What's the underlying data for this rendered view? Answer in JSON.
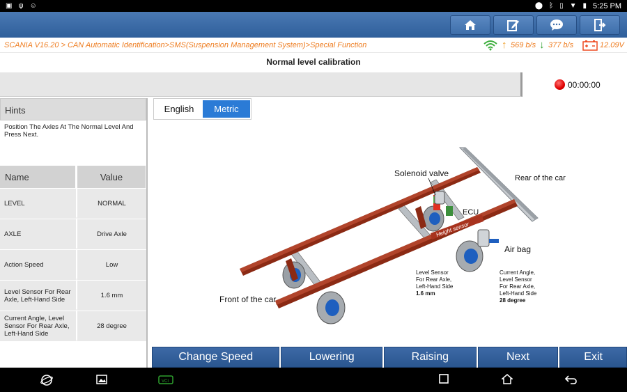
{
  "status_bar": {
    "time": "5:25 PM"
  },
  "breadcrumb": "SCANIA V16.20 > CAN Automatic Identification>SMS(Suspension Management System)>Special Function",
  "rates": {
    "upload": "569 b/s",
    "download": "377 b/s",
    "voltage": "12.09V"
  },
  "page_title": "Normal level calibration",
  "timer": "00:00:00",
  "hints": {
    "header": "Hints",
    "text": "Position The Axles At The Normal Level And Press Next."
  },
  "table": {
    "headers": [
      "Name",
      "Value"
    ],
    "rows": [
      {
        "name": "LEVEL",
        "value": "NORMAL"
      },
      {
        "name": "AXLE",
        "value": "Drive Axle"
      },
      {
        "name": "Action Speed",
        "value": "Low"
      },
      {
        "name": "Level Sensor For Rear Axle, Left-Hand Side",
        "value": "1.6 mm"
      },
      {
        "name": "Current Angle, Level Sensor For Rear Axle, Left-Hand Side",
        "value": "28 degree"
      }
    ]
  },
  "units": {
    "english": "English",
    "metric": "Metric",
    "selected": "Metric"
  },
  "diagram": {
    "solenoid_valve": "Solenoid valve",
    "rear_of_car": "Rear of the car",
    "ecu": "ECU",
    "height_sensor": "Height sensor",
    "air_bag": "Air bag",
    "front_of_car": "Front of the car",
    "level_sensor_label": "Level Sensor\nFor Rear Axle,\nLeft-Hand Side",
    "level_sensor_value": "1.6 mm",
    "angle_label": "Current Angle,\nLevel Sensor\nFor Rear Axle,\nLeft-Hand Side",
    "angle_value": "28 degree"
  },
  "buttons": {
    "change_speed": "Change Speed",
    "lowering": "Lowering",
    "raising": "Raising",
    "next": "Next",
    "exit": "Exit"
  },
  "colors": {
    "accent": "#2b7bd6",
    "toolbar": "#3a6aa8",
    "breadcrumb": "#ee7d21",
    "frame": "#8b2a14"
  }
}
